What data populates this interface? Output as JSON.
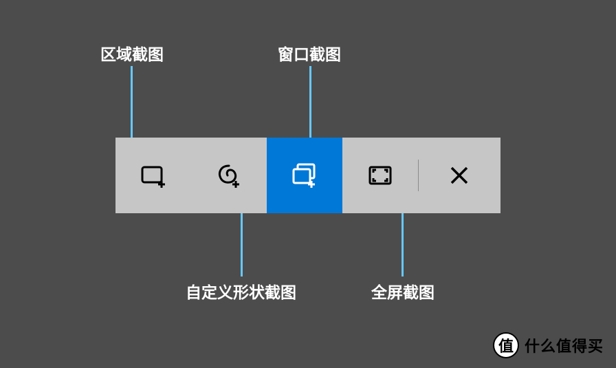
{
  "labels": {
    "region": "区域截图",
    "freeform": "自定义形状截图",
    "window": "窗口截图",
    "fullscreen": "全屏截图"
  },
  "toolbar": {
    "selected_index": 2,
    "buttons": [
      {
        "id": "region",
        "icon": "rectangle-plus-icon"
      },
      {
        "id": "freeform",
        "icon": "freeform-plus-icon"
      },
      {
        "id": "window",
        "icon": "window-plus-icon"
      },
      {
        "id": "fullscreen",
        "icon": "fullscreen-icon"
      }
    ],
    "close_icon": "close-icon"
  },
  "colors": {
    "background": "#4c4c4c",
    "toolbar_bg": "#c6c6c6",
    "selected_bg": "#0078d7",
    "connector": "#67c8ff",
    "label_text": "#ffffff"
  },
  "watermark": {
    "badge": "值",
    "text": "什么值得买"
  }
}
